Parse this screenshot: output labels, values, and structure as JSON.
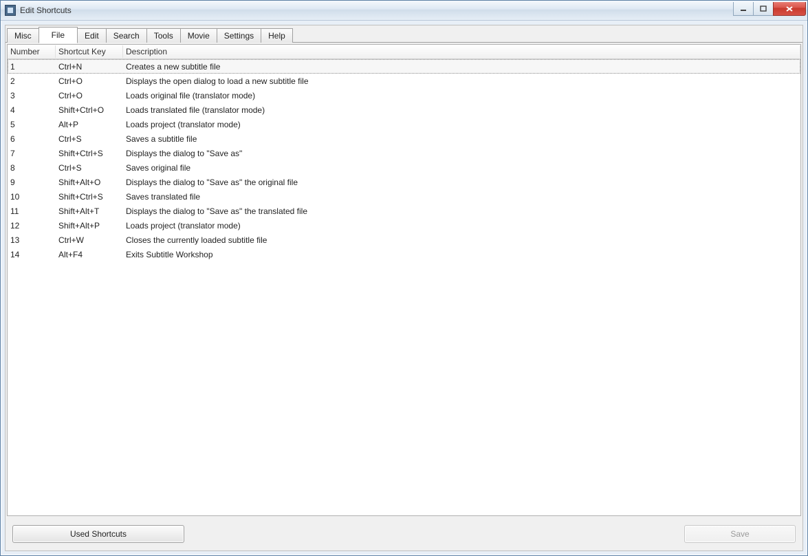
{
  "window": {
    "title": "Edit Shortcuts"
  },
  "tabs": [
    {
      "label": "Misc",
      "active": false
    },
    {
      "label": "File",
      "active": true
    },
    {
      "label": "Edit",
      "active": false
    },
    {
      "label": "Search",
      "active": false
    },
    {
      "label": "Tools",
      "active": false
    },
    {
      "label": "Movie",
      "active": false
    },
    {
      "label": "Settings",
      "active": false
    },
    {
      "label": "Help",
      "active": false
    }
  ],
  "columns": {
    "number": "Number",
    "shortcut": "Shortcut Key",
    "description": "Description"
  },
  "rows": [
    {
      "num": "1",
      "key": "Ctrl+N",
      "desc": "Creates a new subtitle file",
      "selected": true
    },
    {
      "num": "2",
      "key": "Ctrl+O",
      "desc": "Displays the open dialog to load a new subtitle file"
    },
    {
      "num": "3",
      "key": "Ctrl+O",
      "desc": "Loads original file (translator mode)"
    },
    {
      "num": "4",
      "key": "Shift+Ctrl+O",
      "desc": "Loads translated file (translator mode)"
    },
    {
      "num": "5",
      "key": "Alt+P",
      "desc": "Loads project (translator mode)"
    },
    {
      "num": "6",
      "key": "Ctrl+S",
      "desc": "Saves a subtitle file"
    },
    {
      "num": "7",
      "key": "Shift+Ctrl+S",
      "desc": "Displays the dialog to \"Save as\""
    },
    {
      "num": "8",
      "key": "Ctrl+S",
      "desc": "Saves original file"
    },
    {
      "num": "9",
      "key": "Shift+Alt+O",
      "desc": "Displays the dialog to \"Save as\" the original file"
    },
    {
      "num": "10",
      "key": "Shift+Ctrl+S",
      "desc": "Saves translated file"
    },
    {
      "num": "11",
      "key": "Shift+Alt+T",
      "desc": "Displays the dialog to \"Save as\" the translated file"
    },
    {
      "num": "12",
      "key": "Shift+Alt+P",
      "desc": "Loads project (translator mode)"
    },
    {
      "num": "13",
      "key": "Ctrl+W",
      "desc": "Closes the currently loaded subtitle file"
    },
    {
      "num": "14",
      "key": "Alt+F4",
      "desc": "Exits Subtitle Workshop"
    }
  ],
  "buttons": {
    "used_shortcuts": "Used Shortcuts",
    "save": "Save"
  }
}
